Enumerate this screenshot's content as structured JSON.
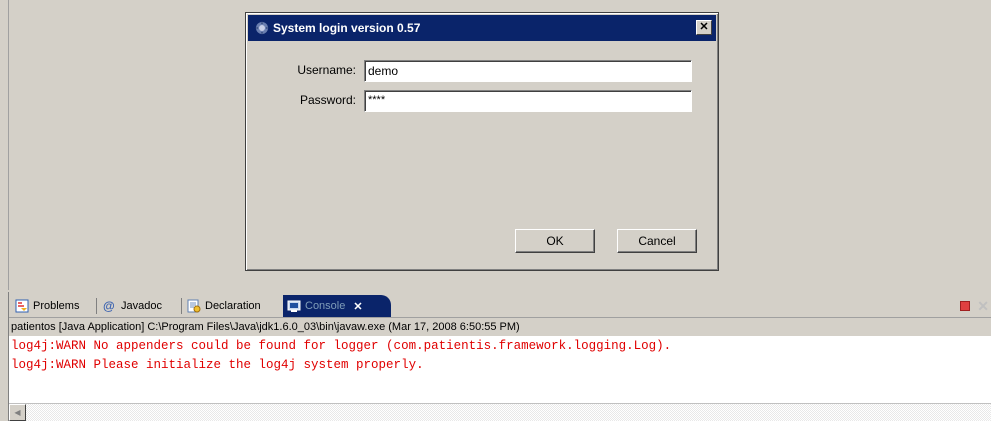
{
  "dialog": {
    "title": "System login version 0.57",
    "close_glyph": "✕",
    "username_label": "Username:",
    "username_value": "demo",
    "password_label": "Password:",
    "password_value": "****",
    "ok_label": "OK",
    "cancel_label": "Cancel"
  },
  "tabs": [
    {
      "label": "Problems",
      "icon": "problems-icon"
    },
    {
      "label": "Javadoc",
      "icon": "at-icon"
    },
    {
      "label": "Declaration",
      "icon": "declaration-icon"
    },
    {
      "label": "Console",
      "icon": "console-icon",
      "active": true
    }
  ],
  "tab_close_glyph": "✕",
  "console": {
    "process_line": "patientos [Java Application] C:\\Program Files\\Java\\jdk1.6.0_03\\bin\\javaw.exe (Mar 17, 2008 6:50:55 PM)",
    "lines": [
      "log4j:WARN No appenders could be found for logger (com.patientis.framework.logging.Log).",
      "log4j:WARN Please initialize the log4j system properly."
    ],
    "text_color": "#e00000"
  },
  "colors": {
    "titlebar": "#0a246a",
    "window_bg": "#d4d0c8"
  }
}
